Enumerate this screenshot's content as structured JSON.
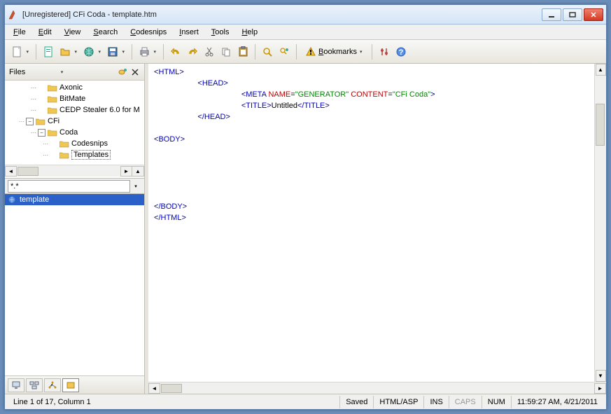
{
  "title": "[Unregistered] CFi Coda - template.htm",
  "menus": {
    "file": "File",
    "edit": "Edit",
    "view": "View",
    "search": "Search",
    "codesnips": "Codesnips",
    "insert": "Insert",
    "tools": "Tools",
    "help": "Help"
  },
  "toolbar": {
    "bookmarks": "Bookmarks"
  },
  "sidebar": {
    "header": "Files",
    "tree": [
      {
        "label": "Axonic",
        "depth": 1,
        "exp": ""
      },
      {
        "label": "BitMate",
        "depth": 1,
        "exp": ""
      },
      {
        "label": "CEDP Stealer 6.0 for M",
        "depth": 1,
        "exp": ""
      },
      {
        "label": "CFi",
        "depth": 0,
        "exp": "-"
      },
      {
        "label": "Coda",
        "depth": 1,
        "exp": "-"
      },
      {
        "label": "Codesnips",
        "depth": 2,
        "exp": ""
      },
      {
        "label": "Templates",
        "depth": 2,
        "exp": "",
        "selected": true
      }
    ],
    "filter": "*.*",
    "files": [
      {
        "name": "template",
        "selected": true
      }
    ]
  },
  "code": {
    "l1": {
      "a": "<",
      "b": "HTML",
      "c": ">"
    },
    "l2": {
      "a": "<",
      "b": "HEAD",
      "c": ">"
    },
    "l3": {
      "a": "<",
      "b": "META",
      "c": " ",
      "d": "NAME",
      "e": "=",
      "f": "\"GENERATOR\"",
      "g": " ",
      "h": "CONTENT",
      "i": "=",
      "j": "\"CFi Coda\"",
      "k": ">"
    },
    "l4": {
      "a": "<",
      "b": "TITLE",
      "c": ">",
      "d": "Untitled",
      "e": "<",
      "f": "/TITLE",
      "g": ">"
    },
    "l5": {
      "a": "<",
      "b": "/HEAD",
      "c": ">"
    },
    "l6": {
      "a": "<",
      "b": "BODY",
      "c": ">"
    },
    "l7": {
      "a": "<",
      "b": "/BODY",
      "c": ">"
    },
    "l8": {
      "a": "<",
      "b": "/HTML",
      "c": ">"
    }
  },
  "status": {
    "pos": "Line 1 of 17, Column 1",
    "saved": "Saved",
    "mode": "HTML/ASP",
    "ins": "INS",
    "caps": "CAPS",
    "num": "NUM",
    "time": "11:59:27 AM, 4/21/2011"
  }
}
